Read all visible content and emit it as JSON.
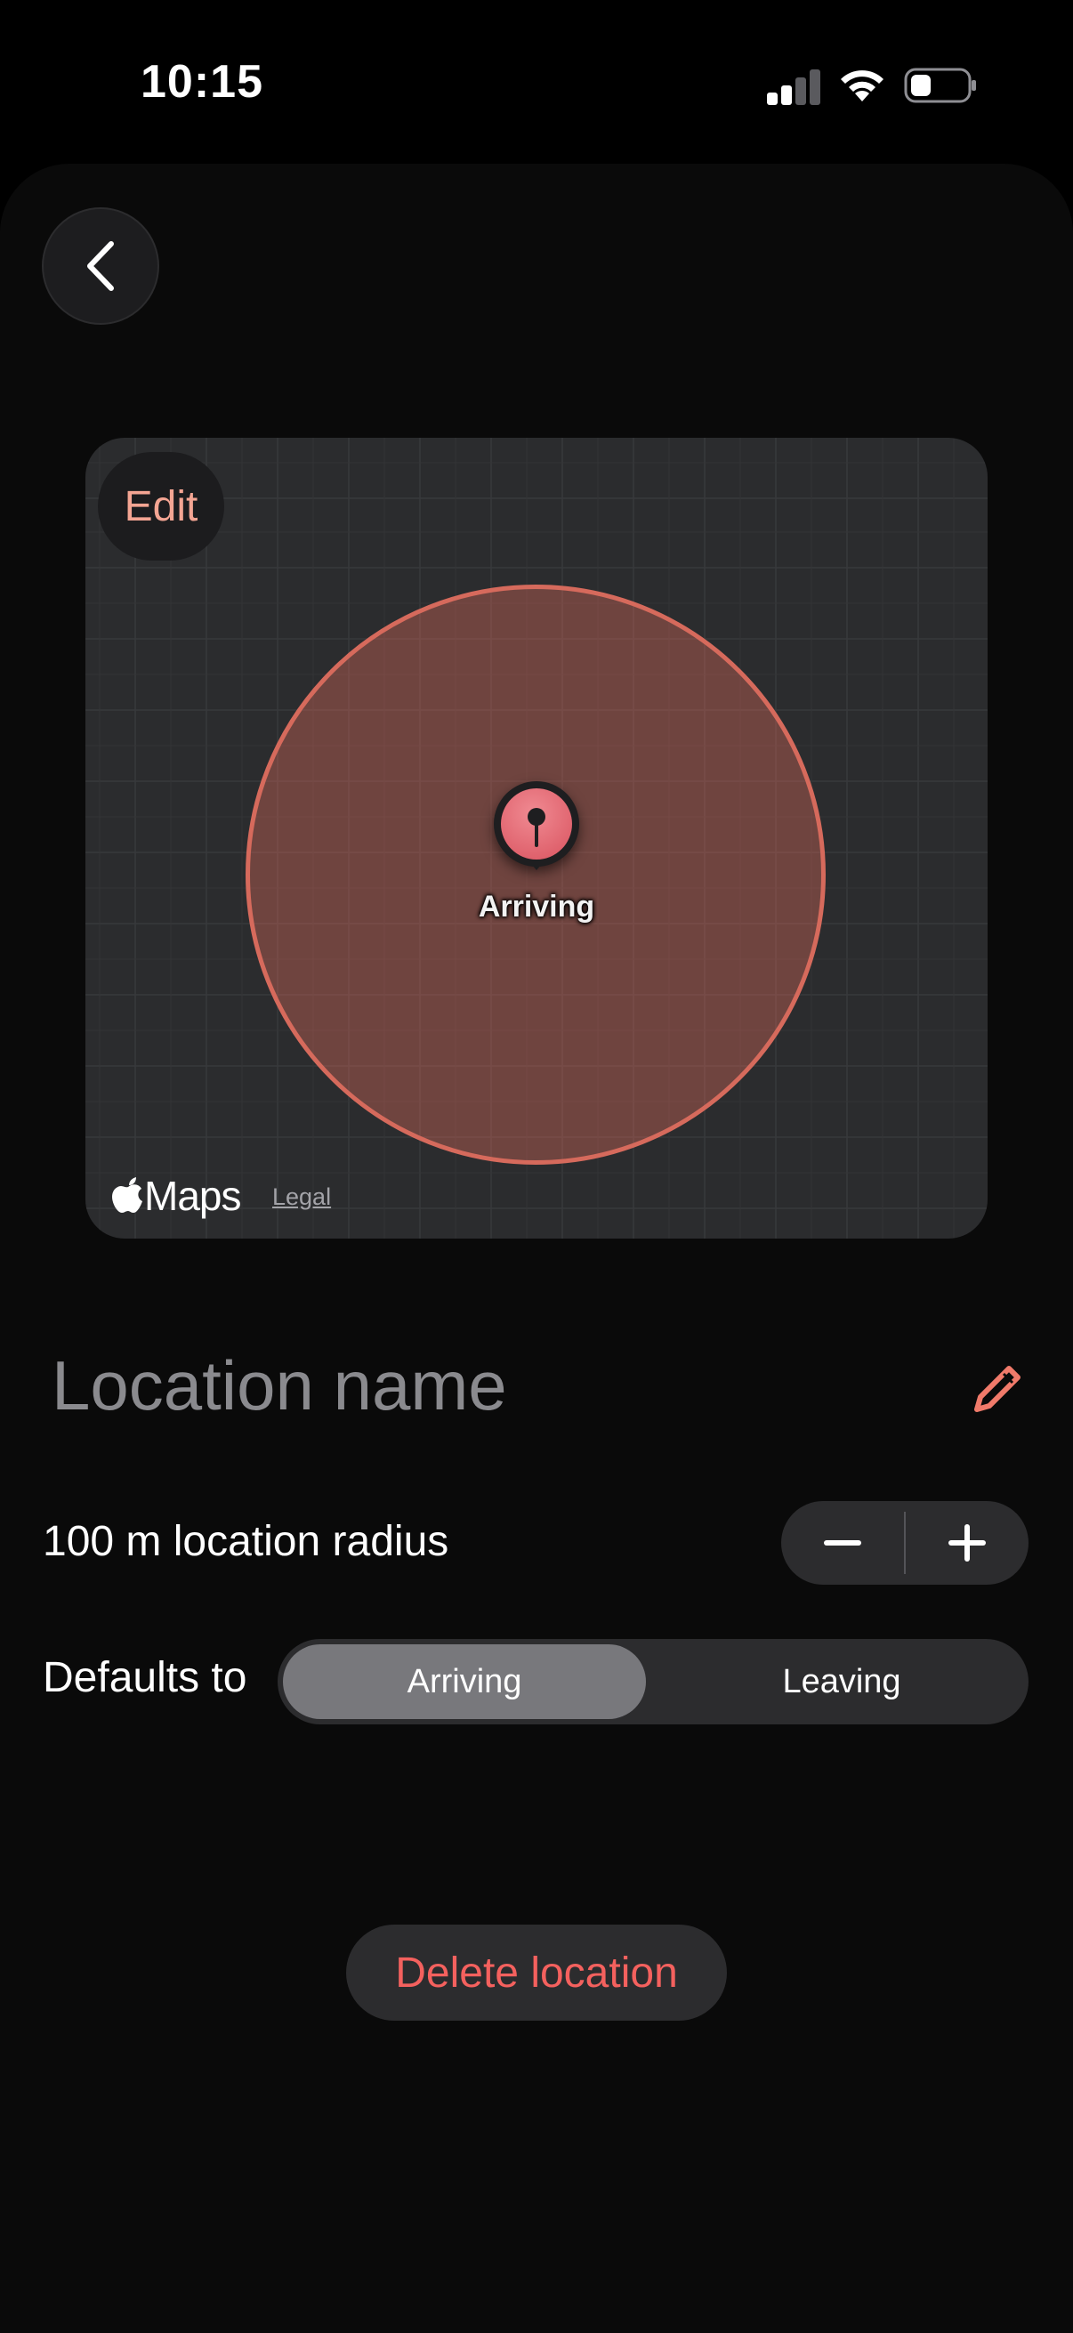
{
  "status_bar": {
    "time": "10:15",
    "icons": [
      "signal-icon",
      "wifi-icon",
      "battery-icon"
    ]
  },
  "header": {
    "back_icon": "chevron-left-icon"
  },
  "map": {
    "edit_label": "Edit",
    "pin_label": "Arriving",
    "brand_label": "Maps",
    "legal_label": "Legal",
    "radius_color": "#d66a5c"
  },
  "location": {
    "name_placeholder": "Location name",
    "edit_icon": "pencil-icon"
  },
  "radius": {
    "label": "100 m location radius",
    "decrement_icon": "minus-icon",
    "increment_icon": "plus-icon"
  },
  "defaults": {
    "label": "Defaults to",
    "options": [
      "Arriving",
      "Leaving"
    ],
    "selected": "Arriving"
  },
  "actions": {
    "delete_label": "Delete location",
    "delete_color": "#f4615e"
  },
  "colors": {
    "accent": "#f07a6a",
    "background": "#000000",
    "sheet": "#0a0a0a"
  }
}
